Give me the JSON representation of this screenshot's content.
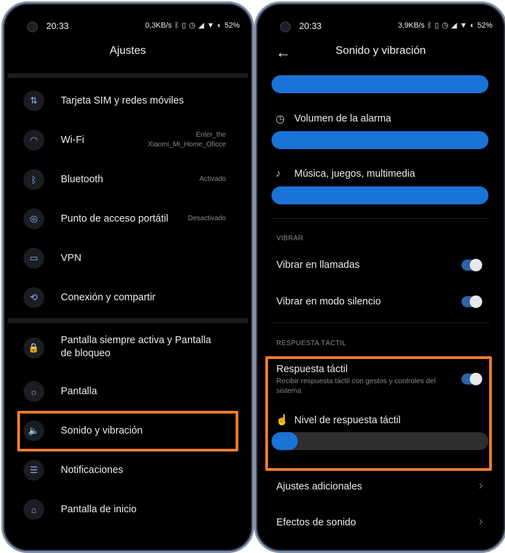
{
  "left": {
    "status": {
      "time": "20:33",
      "net": "0,3KB/s",
      "battery": "52"
    },
    "title": "Ajustes",
    "items": [
      {
        "label": "Tarjeta SIM y redes móviles",
        "value": "",
        "icon": "sim-icon",
        "glyph": "⇅"
      },
      {
        "label": "Wi-Fi",
        "value": "Enter_the\nXiaomi_Mi_Home_Oficce",
        "icon": "wifi-icon",
        "glyph": "◠"
      },
      {
        "label": "Bluetooth",
        "value": "Activado",
        "icon": "bluetooth-icon",
        "glyph": "ᛒ"
      },
      {
        "label": "Punto de acceso portátil",
        "value": "Desactivado",
        "icon": "hotspot-icon",
        "glyph": "◎"
      },
      {
        "label": "VPN",
        "value": "",
        "icon": "vpn-icon",
        "glyph": "▭"
      },
      {
        "label": "Conexión y compartir",
        "value": "",
        "icon": "share-icon",
        "glyph": "⟲"
      },
      {
        "label": "Pantalla siempre activa y Pantalla\nde bloqueo",
        "value": "",
        "icon": "lock-icon",
        "glyph": "🔒"
      },
      {
        "label": "Pantalla",
        "value": "",
        "icon": "brightness-icon",
        "glyph": "☼"
      },
      {
        "label": "Sonido y vibración",
        "value": "",
        "icon": "speaker-icon",
        "glyph": "🔈"
      },
      {
        "label": "Notificaciones",
        "value": "",
        "icon": "notifications-icon",
        "glyph": "☰"
      },
      {
        "label": "Pantalla de inicio",
        "value": "",
        "icon": "home-icon",
        "glyph": "⌂"
      }
    ]
  },
  "right": {
    "status": {
      "time": "20:33",
      "net": "3,9KB/s",
      "battery": "52"
    },
    "title": "Sonido y vibración",
    "alarm_label": "Volumen de la alarma",
    "media_label": "Música, juegos, multimedia",
    "vibrate_header": "VIBRAR",
    "vibrate_calls": "Vibrar en llamadas",
    "vibrate_silent": "Vibrar en modo silencio",
    "haptic_header": "RESPUESTA TÁCTIL",
    "haptic_label": "Respuesta táctil",
    "haptic_sub": "Recibir respuesta táctil con gestos y controles del sistema",
    "haptic_level_label": "Nivel de respuesta táctil",
    "haptic_level": 0.12,
    "additional": "Ajustes adicionales",
    "effects": "Efectos de sonido",
    "toggles": {
      "vibrate_calls": true,
      "vibrate_silent": true,
      "haptic": true
    },
    "sliders": {
      "top": 1.0,
      "alarm": 1.0,
      "media": 1.0
    }
  },
  "colors": {
    "accent": "#1a73d6",
    "highlight": "#f07a2e"
  }
}
